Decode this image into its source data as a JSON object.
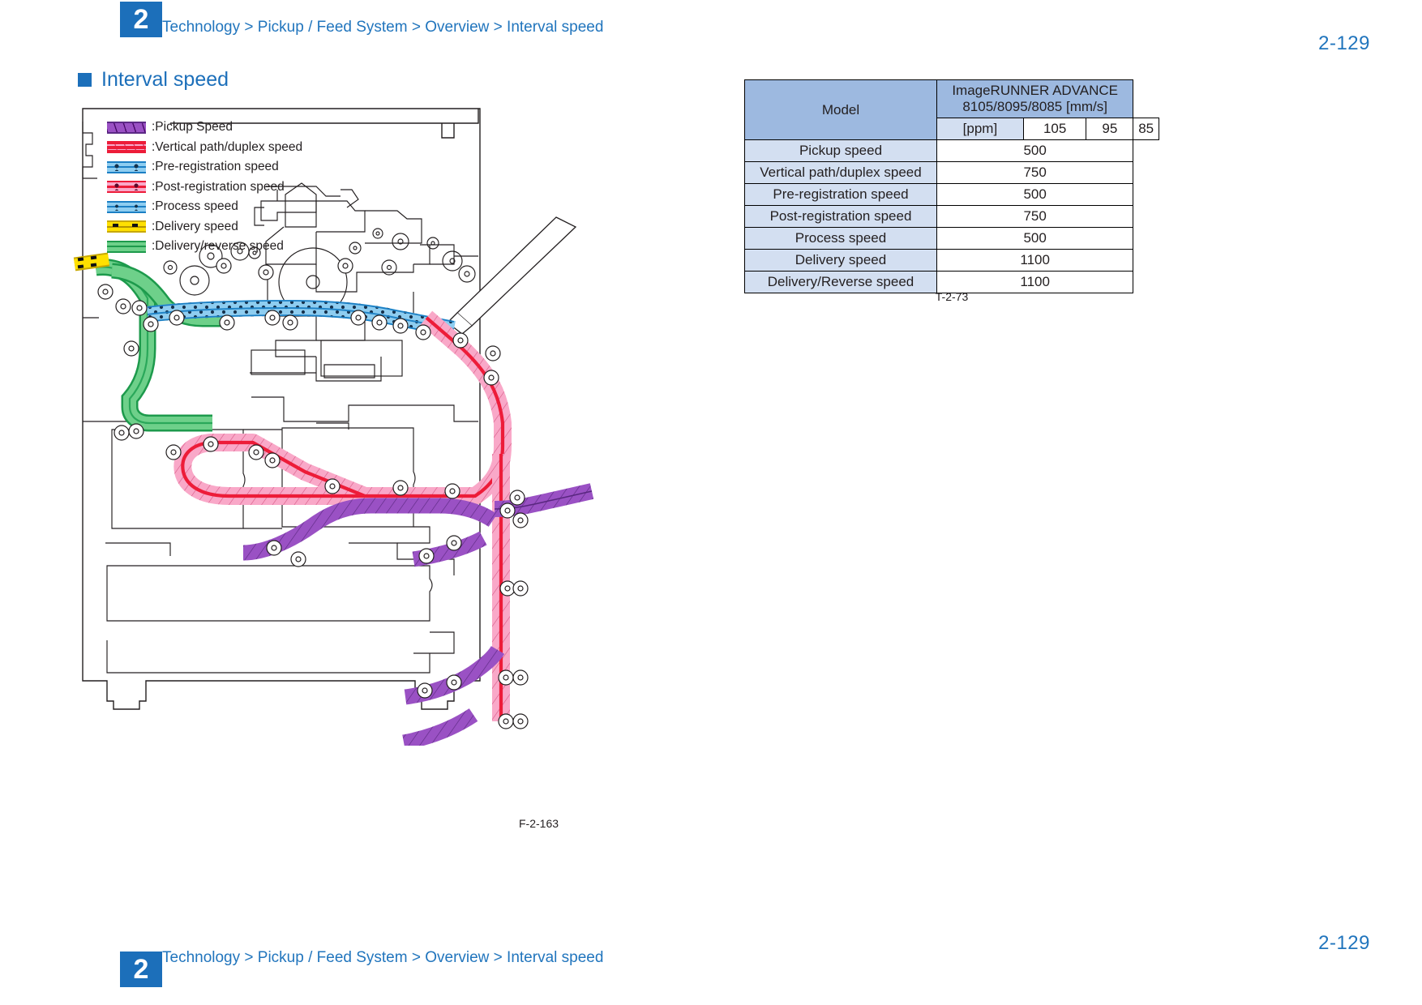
{
  "header": {
    "chapter_number": "2",
    "breadcrumb": "Technology > Pickup / Feed System > Overview > Interval speed",
    "page_number": "2-129"
  },
  "footer": {
    "chapter_number": "2",
    "breadcrumb": "Technology > Pickup / Feed System > Overview > Interval speed",
    "page_number": "2-129"
  },
  "section": {
    "title": "Interval speed",
    "bullet_color": "#1c6fba",
    "title_color": "#1c6fba"
  },
  "legend": {
    "items": [
      {
        "swatch": "pickup-speed-swatch",
        "label": ":Pickup Speed",
        "color": "#9a51c4"
      },
      {
        "swatch": "vertical-duplex-speed-swatch",
        "label": ":Vertical path/duplex speed",
        "color": "#f9a8c8"
      },
      {
        "swatch": "pre-registration-speed-swatch",
        "label": ":Pre-registration speed",
        "color": "#8ecdf0"
      },
      {
        "swatch": "post-registration-speed-swatch",
        "label": ":Post-registration speed",
        "color": "#f9a8c8"
      },
      {
        "swatch": "process-speed-swatch",
        "label": ":Process speed",
        "color": "#8ecdf0"
      },
      {
        "swatch": "delivery-speed-swatch",
        "label": ":Delivery speed",
        "color": "#ffe000"
      },
      {
        "swatch": "delivery-reverse-speed-swatch",
        "label": ":Delivery/reverse speed",
        "color": "#6ed08a"
      }
    ]
  },
  "figure": {
    "caption": "F-2-163",
    "description": "Cross-section diagram of the printer paper feed path with colored speed zones"
  },
  "table": {
    "caption": "T-2-73",
    "header_model_label": "Model",
    "header_model_value_line1": "ImageRUNNER ADVANCE",
    "header_model_value_line2": "8105/8095/8085 [mm/s]",
    "ppm_label": "[ppm]",
    "ppm_values": [
      "105",
      "95",
      "85"
    ],
    "rows": [
      {
        "label": "Pickup speed",
        "value": "500"
      },
      {
        "label": "Vertical path/duplex speed",
        "value": "750"
      },
      {
        "label": "Pre-registration speed",
        "value": "500"
      },
      {
        "label": "Post-registration speed",
        "value": "750"
      },
      {
        "label": "Process speed",
        "value": "500"
      },
      {
        "label": "Delivery speed",
        "value": "1100"
      },
      {
        "label": "Delivery/Reverse speed",
        "value": "1100"
      }
    ],
    "header_bg": "#9db9e0",
    "label_bg": "#d3dff1"
  }
}
